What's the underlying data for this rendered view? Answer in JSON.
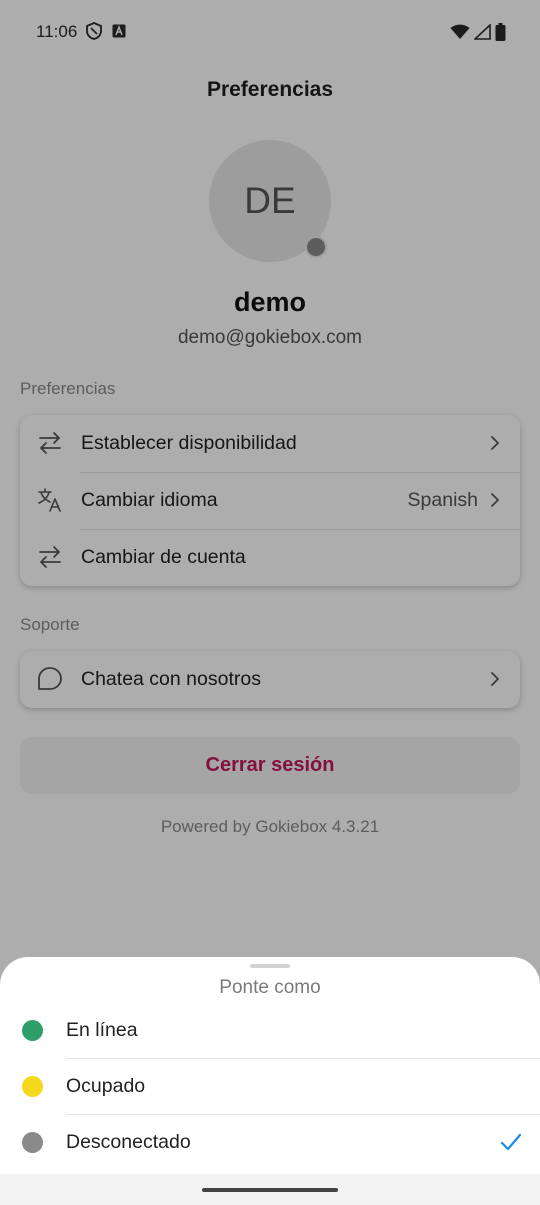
{
  "status_bar": {
    "time": "11:06",
    "left_icons": [
      "shield-icon",
      "a-badge-icon"
    ],
    "right_icons": [
      "wifi-icon",
      "signal-icon",
      "battery-icon"
    ]
  },
  "header": {
    "title": "Preferencias"
  },
  "profile": {
    "initials": "DE",
    "name": "demo",
    "email": "demo@gokiebox.com",
    "presence_color": "#8a8a8a"
  },
  "preferences": {
    "section_label": "Preferencias",
    "items": [
      {
        "icon": "swap-arrows-icon",
        "label": "Establecer disponibilidad",
        "value": ""
      },
      {
        "icon": "translate-icon",
        "label": "Cambiar idioma",
        "value": "Spanish"
      },
      {
        "icon": "swap-arrows-icon",
        "label": "Cambiar de cuenta",
        "value": ""
      }
    ]
  },
  "support": {
    "section_label": "Soporte",
    "items": [
      {
        "icon": "chat-bubble-icon",
        "label": "Chatea con nosotros"
      }
    ]
  },
  "logout": {
    "label": "Cerrar sesión",
    "color": "#c2185b"
  },
  "footer": {
    "powered_by": "Powered by Gokiebox 4.3.21"
  },
  "sheet": {
    "title": "Ponte como",
    "options": [
      {
        "label": "En línea",
        "color": "#2e9e6b",
        "selected": false
      },
      {
        "label": "Ocupado",
        "color": "#f4d81c",
        "selected": false
      },
      {
        "label": "Desconectado",
        "color": "#8a8a8a",
        "selected": true
      }
    ],
    "check_color": "#1e88e5"
  }
}
